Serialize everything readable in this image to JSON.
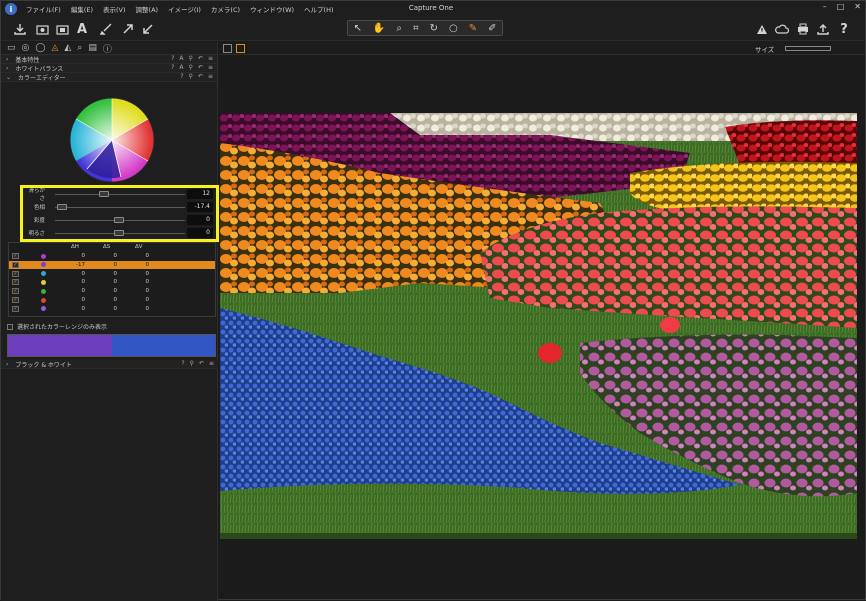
{
  "app": {
    "title": "Capture One",
    "menu": [
      "ファイル(F)",
      "編集(E)",
      "表示(V)",
      "調整(A)",
      "イメージ(I)",
      "カメラ(C)",
      "ウィンドウ(W)",
      "ヘルプ(H)"
    ],
    "window_controls": [
      "–",
      "□",
      "✕"
    ]
  },
  "toolbar": {
    "left_icons": [
      "import-icon",
      "capture-icon",
      "camera-icon",
      "text-auto-icon",
      "brush-icon",
      "arrow-up-right-icon",
      "arrow-down-left-icon"
    ],
    "cursor_tools": [
      "pointer-icon",
      "pan-icon",
      "loupe-icon",
      "crop-icon",
      "rotate-icon",
      "circle-icon",
      "color-picker-icon",
      "annotate-icon"
    ],
    "active_cursor_index": 6,
    "right_icons": [
      "warning-icon",
      "cloud-icon",
      "print-icon",
      "export-icon",
      "help-icon"
    ]
  },
  "left_panel": {
    "tool_tabs": [
      "folder-icon",
      "capture-tab-icon",
      "lens-icon",
      "color-tab-icon",
      "exposure-icon",
      "search-icon",
      "metadata-icon",
      "info-icon"
    ],
    "active_tab_index": 3,
    "sections": {
      "basic": "基本特性",
      "white_balance": "ホワイトバランス",
      "color_editor": "カラーエディター",
      "bw": "ブラック & ホワイト"
    },
    "sliders": [
      {
        "label": "滑らかさ",
        "value": "12",
        "pos": 0.6
      },
      {
        "label": "色相",
        "value": "-17.4",
        "pos": 0.05
      },
      {
        "label": "彩度",
        "value": "0",
        "pos": 0.5
      },
      {
        "label": "明るさ",
        "value": "0",
        "pos": 0.5
      }
    ],
    "table_headers": [
      "ΔH",
      "ΔS",
      "ΔV"
    ],
    "table_rows": [
      {
        "color": "#b03bd4",
        "h": "0",
        "s": "0",
        "v": "0",
        "checked": true,
        "selected": false
      },
      {
        "color": "#7a3bd4",
        "h": "-17",
        "s": "0",
        "v": "0",
        "checked": true,
        "selected": true
      },
      {
        "color": "#2fa6d9",
        "h": "0",
        "s": "0",
        "v": "0",
        "checked": true,
        "selected": false
      },
      {
        "color": "#d8d23a",
        "h": "0",
        "s": "0",
        "v": "0",
        "checked": true,
        "selected": false
      },
      {
        "color": "#3fae3f",
        "h": "0",
        "s": "0",
        "v": "0",
        "checked": true,
        "selected": false
      },
      {
        "color": "#d84a2f",
        "h": "0",
        "s": "0",
        "v": "0",
        "checked": true,
        "selected": false
      },
      {
        "color": "#9a5adf",
        "h": "0",
        "s": "0",
        "v": "0",
        "checked": true,
        "selected": false
      }
    ],
    "only_selected_label": "選択されたカラーレンジのみ表示",
    "swatch_colors": [
      "#6c3dbd",
      "#3256c3"
    ]
  },
  "viewer": {
    "size_label": "サイズ"
  },
  "colors": {
    "accent": "#e28a1e",
    "highlight": "#f6f21e"
  }
}
